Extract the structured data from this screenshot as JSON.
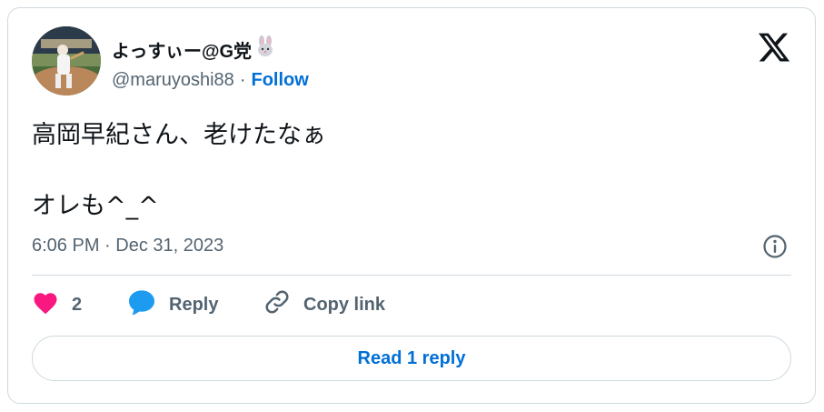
{
  "author": {
    "display_name": "よっすぃー@G党",
    "name_emoji": "🐰",
    "handle": "@maruyoshi88",
    "separator": "·",
    "follow_label": "Follow"
  },
  "tweet": {
    "line1": "高岡早紀さん、老けたなぁ",
    "line2": "オレも^_^",
    "timestamp": "6:06 PM · Dec 31, 2023"
  },
  "actions": {
    "like_count": "2",
    "reply_label": "Reply",
    "copy_link_label": "Copy link"
  },
  "read_replies_label": "Read 1 reply",
  "icons": [
    "x-logo-icon",
    "info-icon",
    "heart-icon",
    "reply-bubble-icon",
    "link-icon",
    "rabbit-emoji-icon"
  ],
  "colors": {
    "heart": "#f91880",
    "reply_icon": "#1d9bf0",
    "link_blue": "#006fd6",
    "muted": "#536471",
    "border": "#cfd9de"
  }
}
